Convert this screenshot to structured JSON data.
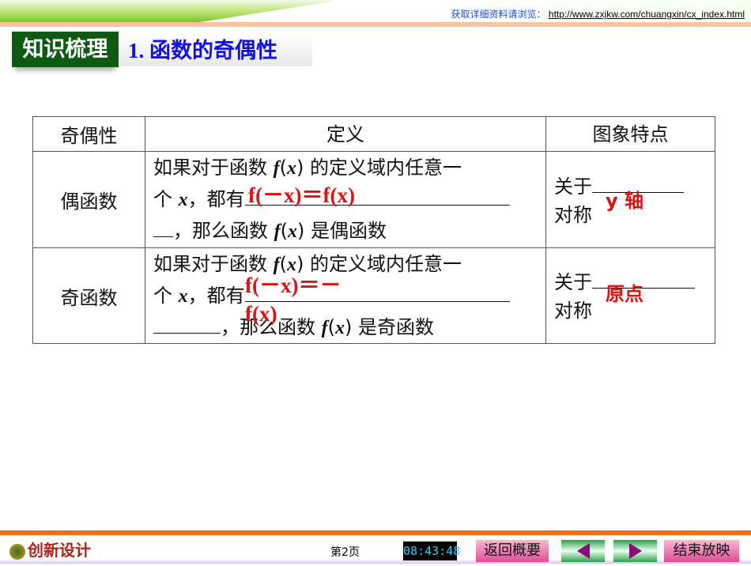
{
  "header": {
    "link_label": "获取详细资料请浏览：",
    "link_url": "http://www.zxjkw.com/chuangxin/cx_index.html"
  },
  "section_tag": "知识梳理",
  "section_title": "1. 函数的奇偶性",
  "table": {
    "headers": [
      "奇偶性",
      "定义",
      "图象特点"
    ],
    "rows": [
      {
        "name": "偶函数",
        "def_l1_a": "如果对于函数 ",
        "f": "f",
        "x": "x",
        "def_l1_b": " 的定义域内任意一",
        "def_l2_a": "个 ",
        "def_l2_b": "，都有",
        "def_l3_b": "，那么函数 ",
        "def_l3_c": " 是偶函数",
        "answer": "f(－x)＝f(x)",
        "feat_a": "关于",
        "feat_answer": "y 轴",
        "feat_b": "对称"
      },
      {
        "name": "奇函数",
        "def_l1_a": "如果对于函数 ",
        "f": "f",
        "x": "x",
        "def_l1_b": " 的定义域内任意一",
        "def_l2_a": "个 ",
        "def_l2_b": "，都有",
        "def_l3_b": "，那么函数 ",
        "def_l3_c": " 是奇函数",
        "answer_a": "f(－x)＝－",
        "answer_b": "f(x)",
        "feat_a": "关于",
        "feat_answer": "原点",
        "feat_b": "对称"
      }
    ]
  },
  "footer": {
    "logo": "创新设计",
    "page": "第2页",
    "clock": "08:43:48",
    "back": "返回概要",
    "end": "结束放映"
  }
}
